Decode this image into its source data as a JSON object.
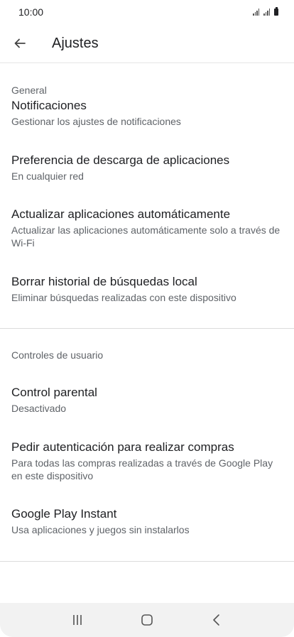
{
  "status_bar": {
    "time": "10:00"
  },
  "app_bar": {
    "title": "Ajustes",
    "back_icon": "arrow-left-icon"
  },
  "sections": [
    {
      "header": "General",
      "items": [
        {
          "title": "Notificaciones",
          "subtitle": "Gestionar los ajustes de notificaciones"
        },
        {
          "title": "Preferencia de descarga de aplicaciones",
          "subtitle": "En cualquier red"
        },
        {
          "title": "Actualizar aplicaciones automáticamente",
          "subtitle": "Actualizar las aplicaciones automáticamente solo a través de Wi-Fi"
        },
        {
          "title": "Borrar historial de búsquedas local",
          "subtitle": "Eliminar búsquedas realizadas con este dispositivo"
        }
      ]
    },
    {
      "header": "Controles de usuario",
      "items": [
        {
          "title": "Control parental",
          "subtitle": "Desactivado"
        },
        {
          "title": "Pedir autenticación para realizar compras",
          "subtitle": "Para todas las compras realizadas a través de Google Play en este dispositivo"
        },
        {
          "title": "Google Play Instant",
          "subtitle": "Usa aplicaciones y juegos sin instalarlos"
        }
      ]
    }
  ],
  "nav_bar": {
    "icons": [
      "recent-apps-icon",
      "home-icon",
      "back-icon"
    ]
  }
}
